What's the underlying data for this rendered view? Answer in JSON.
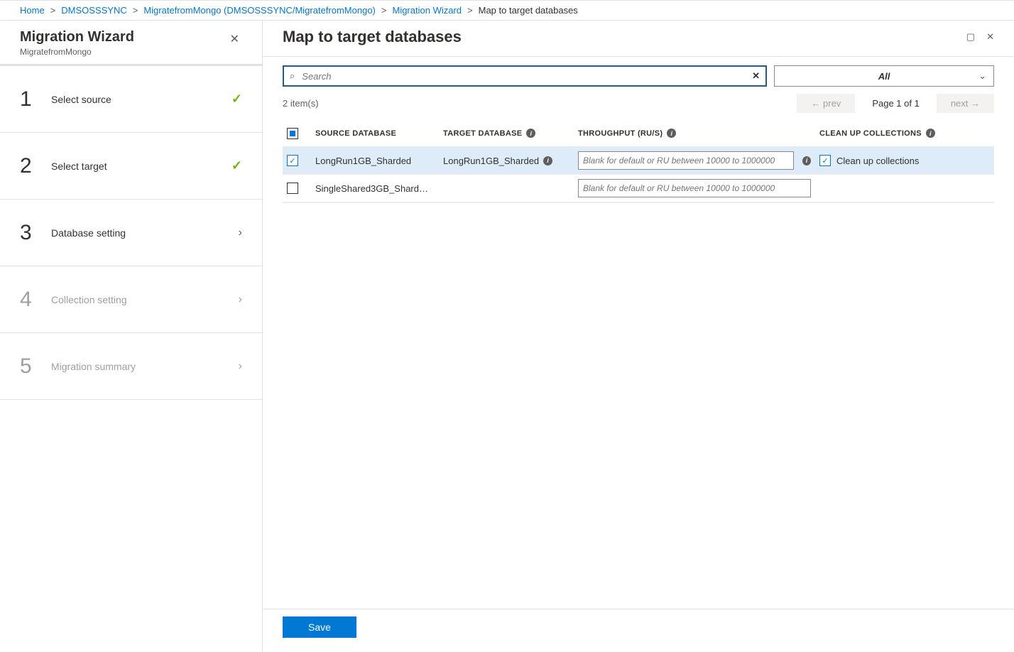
{
  "breadcrumb": {
    "home": "Home",
    "svc": "DMSOSSSYNC",
    "proj": "MigratefromMongo (DMSOSSSYNC/MigratefromMongo)",
    "wizard": "Migration Wizard",
    "current": "Map to target databases",
    "sep": ">"
  },
  "sidebar": {
    "title": "Migration Wizard",
    "subtitle": "MigratefromMongo",
    "steps": [
      {
        "num": "1",
        "label": "Select source",
        "state": "done"
      },
      {
        "num": "2",
        "label": "Select target",
        "state": "done"
      },
      {
        "num": "3",
        "label": "Database setting",
        "state": "current"
      },
      {
        "num": "4",
        "label": "Collection setting",
        "state": "disabled"
      },
      {
        "num": "5",
        "label": "Migration summary",
        "state": "disabled"
      }
    ]
  },
  "blade": {
    "title": "Map to target databases",
    "search_placeholder": "Search",
    "filter_value": "All",
    "item_count": "2 item(s)",
    "pager_prev": "← prev",
    "pager_page": "Page 1 of 1",
    "pager_next": "next →",
    "columns": {
      "source": "SOURCE DATABASE",
      "target": "TARGET DATABASE",
      "throughput": "THROUGHPUT (RU/S)",
      "cleanup": "CLEAN UP COLLECTIONS"
    },
    "ru_placeholder": "Blank for default or RU between 10000 to 1000000",
    "cleanup_label": "Clean up collections",
    "rows": [
      {
        "selected": true,
        "source": "LongRun1GB_Sharded",
        "target": "LongRun1GB_Sharded",
        "cleanup_checked": true
      },
      {
        "selected": false,
        "source": "SingleShared3GB_Shard…",
        "target": "",
        "cleanup_checked": false
      }
    ],
    "save": "Save"
  }
}
